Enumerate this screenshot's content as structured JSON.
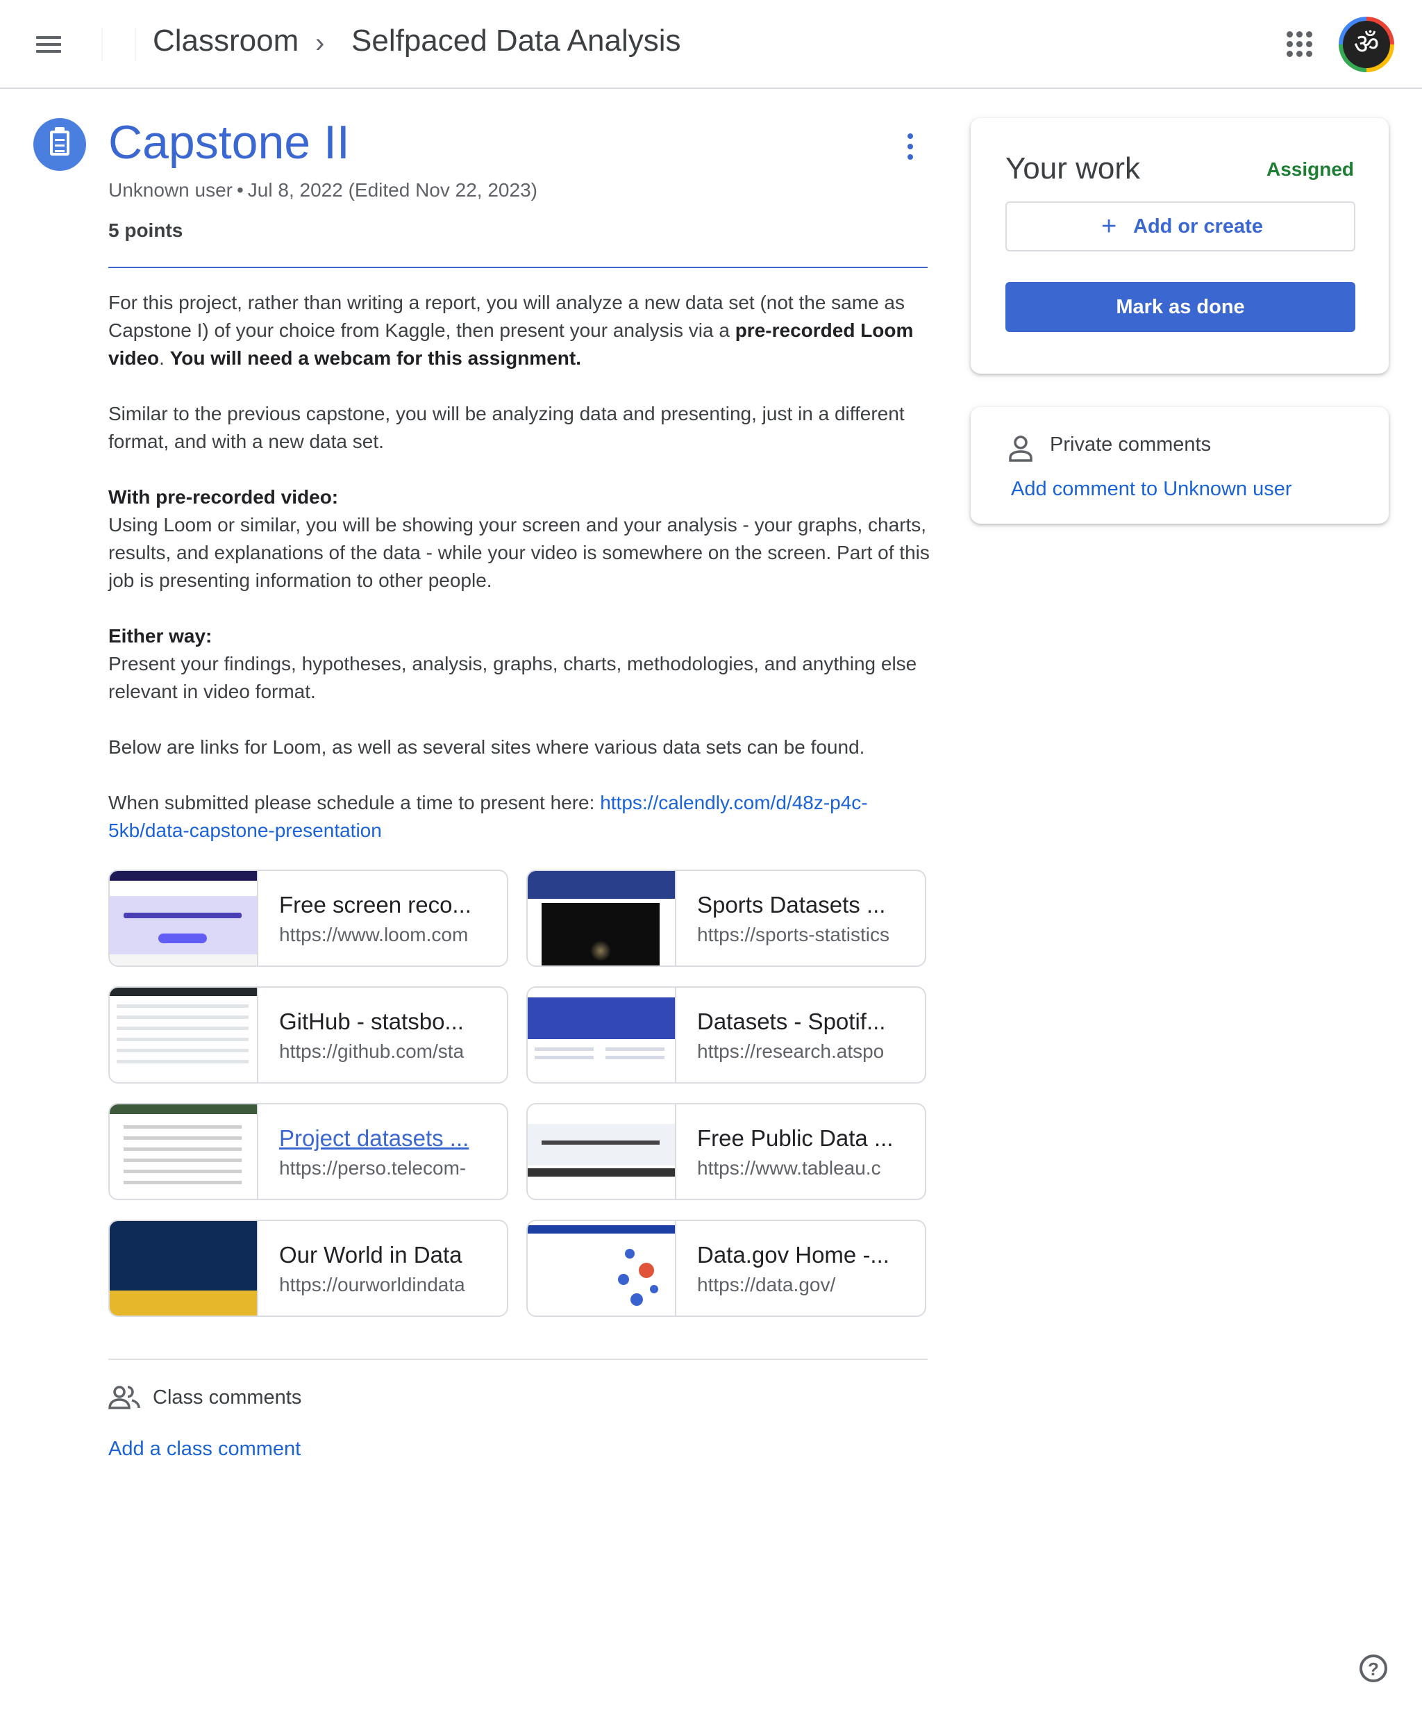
{
  "header": {
    "breadcrumb": [
      "Classroom",
      "Selfpaced Data Analysis"
    ],
    "separator": "›"
  },
  "assignment": {
    "title": "Capstone II",
    "author": "Unknown user",
    "posted": "Jul 8, 2022",
    "edited": "(Edited Nov 22, 2023)",
    "points": "5 points",
    "description": {
      "p1_text": "For this project, rather than writing a report, you will analyze a new data set (not the same as Capstone I) of your choice from Kaggle, then present your analysis via a ",
      "p1_bold": "pre-recorded Loom video",
      "p1_mid": ". ",
      "p1_bold2": "You will need a webcam for this assignment.",
      "p2": "Similar to the previous capstone, you will be analyzing data and presenting, just in a different format, and with a new data set.",
      "p3_heading": "With pre-recorded video:",
      "p3": "Using Loom or similar, you will be showing your screen and your analysis - your graphs, charts, results, and explanations of the data - while your video is somewhere on the screen. Part of this job is presenting information to other people.",
      "p4_heading": "Either way:",
      "p4": "Present your findings, hypotheses, analysis, graphs, charts, methodologies, and anything else relevant in video format.",
      "p5": "Below are links for Loom, as well as several sites where various data sets can be found.",
      "p6_text": "When submitted please schedule a time to present here: ",
      "p6_link": "https://calendly.com/d/48z-p4c-5kb/data-capstone-presentation"
    },
    "attachments": [
      {
        "title": "Free screen reco...",
        "url": "https://www.loom.com"
      },
      {
        "title": "Sports Datasets ...",
        "url": "https://sports-statistics"
      },
      {
        "title": "GitHub - statsbo...",
        "url": "https://github.com/sta"
      },
      {
        "title": "Datasets - Spotif...",
        "url": "https://research.atspo"
      },
      {
        "title": "Project datasets ...",
        "url": "https://perso.telecom-"
      },
      {
        "title": "Free Public Data ...",
        "url": "https://www.tableau.c"
      },
      {
        "title": "Our World in Data",
        "url": "https://ourworldindata"
      },
      {
        "title": "Data.gov Home -...",
        "url": "https://data.gov/"
      }
    ]
  },
  "class_comments": {
    "label": "Class comments",
    "add": "Add a class comment"
  },
  "your_work": {
    "title": "Your work",
    "status": "Assigned",
    "add_label": "Add or create",
    "done_label": "Mark as done"
  },
  "private_comments": {
    "label": "Private comments",
    "add": "Add comment to Unknown user"
  },
  "colors": {
    "accent": "#3b67d1",
    "link": "#1a62d6",
    "status": "#1e7e34"
  }
}
